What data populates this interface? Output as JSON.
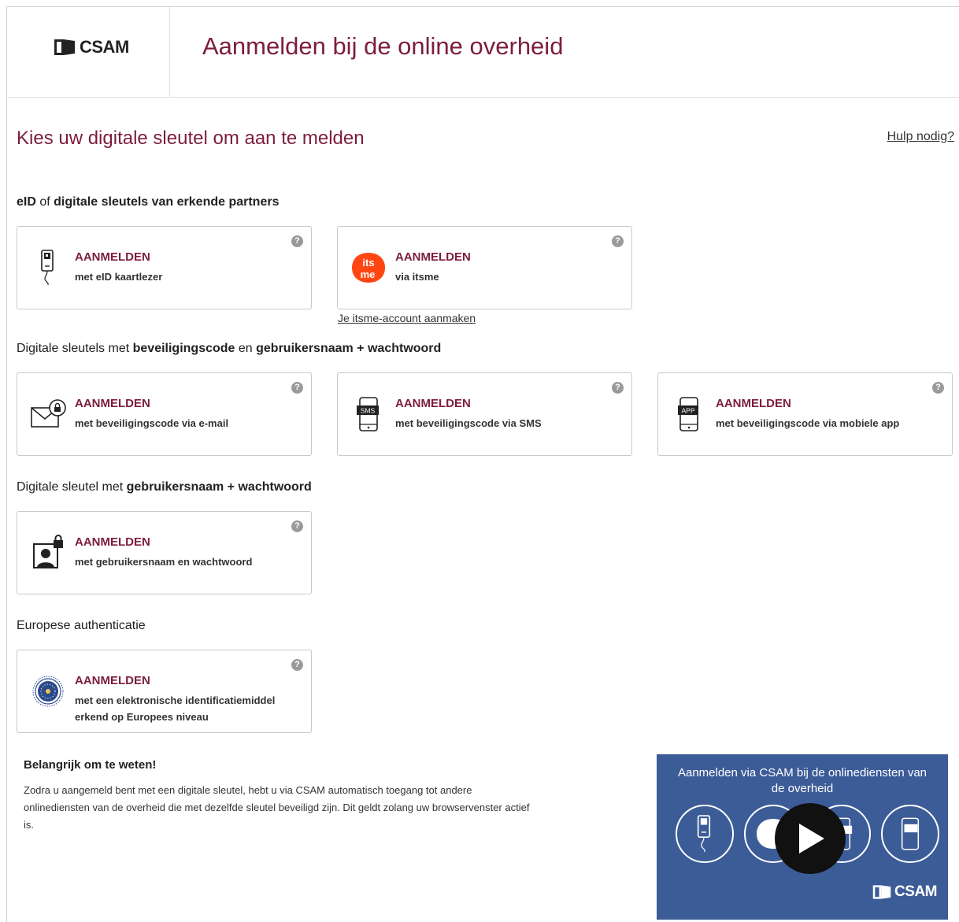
{
  "header": {
    "logo_text": "CSAM",
    "title": "Aanmelden bij de online overheid"
  },
  "page": {
    "title": "Kies uw digitale sleutel om aan te melden",
    "help_link": "Hulp nodig?"
  },
  "sections": {
    "eid": {
      "part1": "eID",
      "part2": " of ",
      "part3": "digitale sleutels van erkende partners"
    },
    "code": {
      "part1": "Digitale sleutels met ",
      "part2": "beveiligingscode",
      "part3": " en ",
      "part4": "gebruikersnaam + wachtwoord"
    },
    "userpass": {
      "part1": "Digitale sleutel met ",
      "part2": "gebruikersnaam + wachtwoord"
    },
    "europe": {
      "part1": "Europese authenticatie"
    }
  },
  "cards": {
    "eid": {
      "title": "AANMELDEN",
      "subtitle": "met eID kaartlezer"
    },
    "itsme": {
      "title": "AANMELDEN",
      "subtitle": "via itsme",
      "logo_top": "its",
      "logo_bottom": "me"
    },
    "email": {
      "title": "AANMELDEN",
      "subtitle": "met beveiligingscode via e-mail"
    },
    "sms": {
      "title": "AANMELDEN",
      "subtitle": "met beveiligingscode via SMS",
      "badge": "SMS"
    },
    "app": {
      "title": "AANMELDEN",
      "subtitle": "met beveiligingscode via mobiele app",
      "badge": "APP"
    },
    "password": {
      "title": "AANMELDEN",
      "subtitle": "met gebruikersnaam en wachtwoord"
    },
    "eidas": {
      "title": "AANMELDEN",
      "subtitle": "met een elektronische identificatiemiddel erkend op Europees niveau"
    }
  },
  "help_icon": "?",
  "itsme_link": "Je itsme-account aanmaken",
  "info": {
    "title": "Belangrijk om te weten!",
    "text": "Zodra u aangemeld bent met een digitale sleutel, hebt u via CSAM automatisch toegang tot andere onlinediensten van de overheid die met dezelfde sleutel beveiligd zijn. Dit geldt zolang uw browservenster actief is."
  },
  "video": {
    "title": "Aanmelden via CSAM bij de onlinediensten van de overheid",
    "logo_text": "CSAM",
    "icons": [
      "card-reader-icon",
      "itsme-icon",
      "app-icon",
      "sms-icon"
    ]
  },
  "colors": {
    "brand": "#7c1d3f",
    "itsme": "#ff4612",
    "video_bg": "#3c5c98"
  }
}
